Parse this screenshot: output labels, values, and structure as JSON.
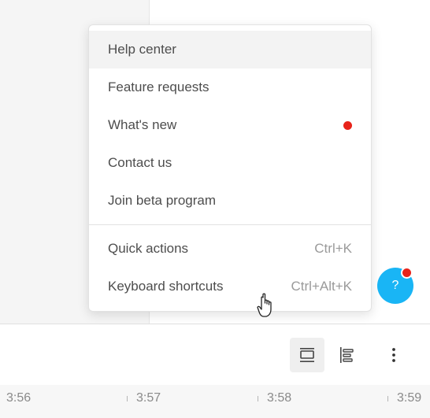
{
  "menu": {
    "items": [
      {
        "label": "Help center"
      },
      {
        "label": "Feature requests"
      },
      {
        "label": "What's new",
        "badge": "new-dot"
      },
      {
        "label": "Contact us"
      },
      {
        "label": "Join beta program"
      }
    ],
    "shortcut_items": [
      {
        "label": "Quick actions",
        "shortcut": "Ctrl+K"
      },
      {
        "label": "Keyboard shortcuts",
        "shortcut": "Ctrl+Alt+K"
      }
    ]
  },
  "help_button": {
    "label": "?",
    "accent": "#19b5f5",
    "badge_color": "#e8231a"
  },
  "toolbar": {
    "icons": [
      "layout-toggle-icon",
      "tree-align-icon",
      "more-vertical-icon"
    ]
  },
  "timeline": {
    "ticks": [
      "3:56",
      "3:57",
      "3:58",
      "3:59"
    ]
  }
}
